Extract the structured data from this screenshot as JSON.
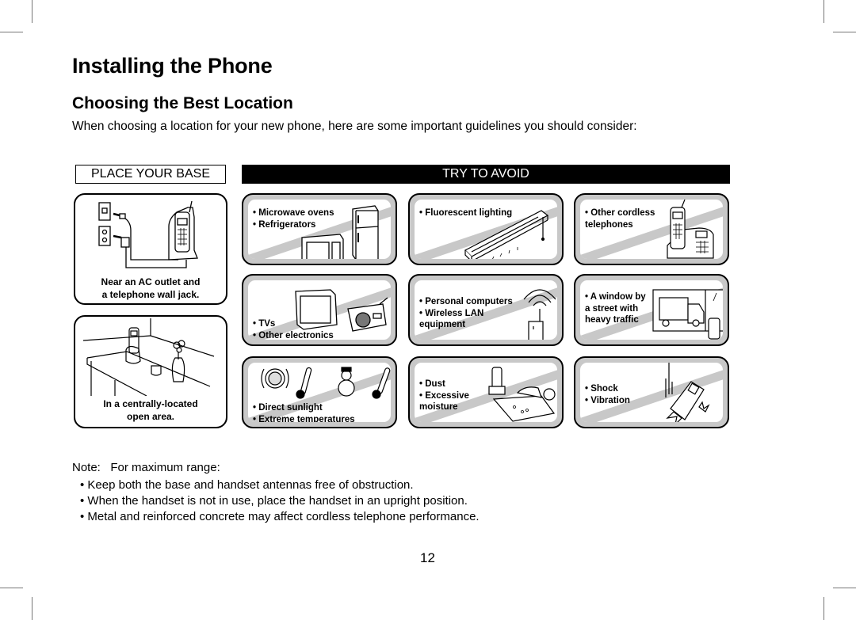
{
  "page": {
    "title": "Installing the Phone",
    "subtitle": "Choosing the Best Location",
    "intro": "When choosing a location for your new phone, here are some important guidelines you should consider:",
    "page_number": "12"
  },
  "place_your_base": {
    "header": "PLACE YOUR BASE",
    "cards": [
      {
        "illustration": "phone-base-with-outlet-icon",
        "caption_lines": [
          "Near an AC outlet and",
          "a telephone wall jack."
        ]
      },
      {
        "illustration": "phone-on-table-icon",
        "caption_lines": [
          "In a centrally-located",
          "open area."
        ]
      }
    ]
  },
  "try_to_avoid": {
    "header": "TRY TO AVOID",
    "cards": [
      {
        "illustration": "microwave-refrigerator-icon",
        "items": [
          "Microwave ovens",
          "Refrigerators"
        ]
      },
      {
        "illustration": "fluorescent-light-icon",
        "items": [
          "Fluorescent lighting"
        ]
      },
      {
        "illustration": "cordless-phone-icon",
        "items": [
          "Other cordless telephones"
        ]
      },
      {
        "illustration": "tv-radio-icon",
        "items": [
          "TVs",
          "Other electronics"
        ]
      },
      {
        "illustration": "wireless-router-icon",
        "items": [
          "Personal computers",
          "Wireless LAN equipment"
        ]
      },
      {
        "illustration": "window-truck-icon",
        "items": [
          "A window by a street with heavy traffic"
        ]
      },
      {
        "illustration": "sun-thermometer-snowman-icon",
        "items": [
          "Direct sunlight",
          "Extreme temperatures"
        ]
      },
      {
        "illustration": "sink-phone-icon",
        "items": [
          "Dust",
          "Excessive moisture"
        ]
      },
      {
        "illustration": "dropped-phone-icon",
        "items": [
          "Shock",
          "Vibration"
        ]
      }
    ]
  },
  "note": {
    "label": "Note:",
    "text": "For maximum range:",
    "bullets": [
      "Keep both the base and handset antennas free of obstruction.",
      "When the handset is not in use, place the handset in an upright position.",
      "Metal and reinforced concrete may affect cordless telephone performance."
    ]
  },
  "colors": {
    "text": "#000000",
    "header_bg": "#000000",
    "header_text": "#ffffff",
    "card_stripe": "#c8c8c8",
    "crop_marks": "#777777"
  }
}
